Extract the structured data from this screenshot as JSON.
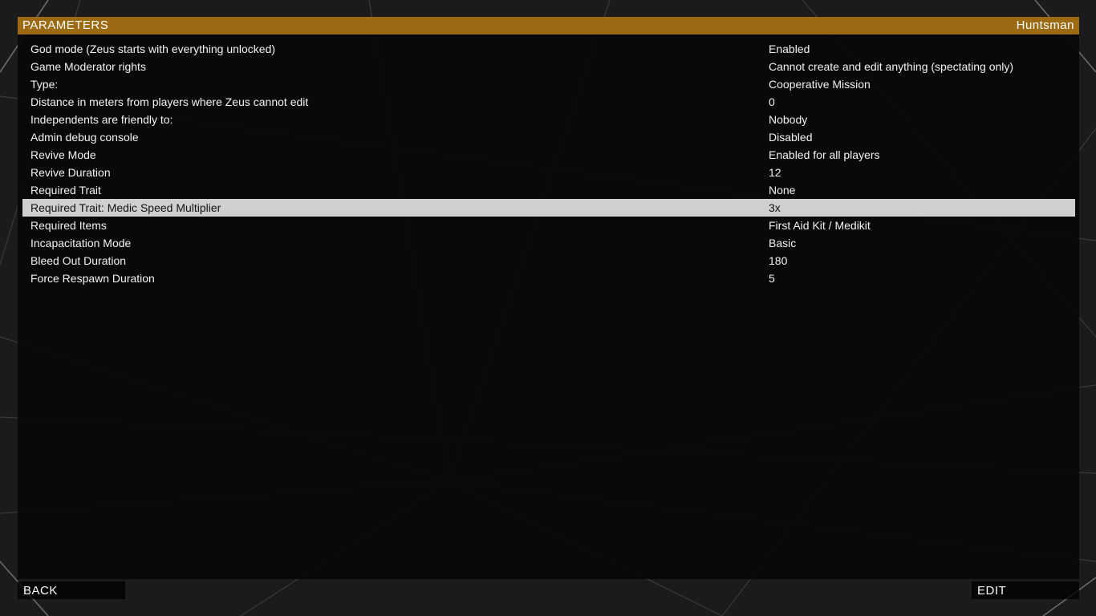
{
  "header": {
    "title": "PARAMETERS",
    "mission_name": "Huntsman"
  },
  "colors": {
    "header_bar": "#9b6a12",
    "selected_row": "#cfcfcf",
    "panel": "#080808"
  },
  "parameters": [
    {
      "name": "God mode (Zeus starts with everything unlocked)",
      "value": "Enabled"
    },
    {
      "name": "Game Moderator rights",
      "value": "Cannot create and edit anything (spectating only)"
    },
    {
      "name": "Type:",
      "value": "Cooperative Mission"
    },
    {
      "name": "Distance in meters from players where Zeus cannot edit",
      "value": "0"
    },
    {
      "name": "Independents are friendly to:",
      "value": "Nobody"
    },
    {
      "name": "Admin debug console",
      "value": "Disabled"
    },
    {
      "name": "Revive Mode",
      "value": "Enabled for all players"
    },
    {
      "name": "Revive Duration",
      "value": "12"
    },
    {
      "name": "Required Trait",
      "value": "None"
    },
    {
      "name": "Required Trait: Medic Speed Multiplier",
      "value": "3x"
    },
    {
      "name": "Required Items",
      "value": "First Aid Kit / Medikit"
    },
    {
      "name": "Incapacitation Mode",
      "value": "Basic"
    },
    {
      "name": "Bleed Out Duration",
      "value": "180"
    },
    {
      "name": "Force Respawn Duration",
      "value": "5"
    }
  ],
  "selected_index": 9,
  "footer": {
    "back_label": "BACK",
    "edit_label": "EDIT"
  }
}
